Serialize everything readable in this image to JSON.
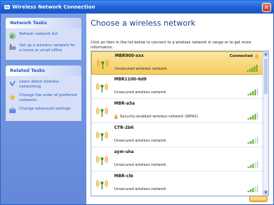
{
  "window": {
    "title": "Wireless Network Connection",
    "close_label": "✕"
  },
  "sidebar": {
    "network_tasks": {
      "title": "Network Tasks",
      "items": [
        {
          "label": "Refresh network list",
          "icon": "refresh-icon"
        },
        {
          "label": "Set up a wireless network for a home or small office",
          "icon": "setup-network-icon"
        }
      ]
    },
    "related_tasks": {
      "title": "Related Tasks",
      "items": [
        {
          "label": "Learn about wireless networking",
          "icon": "info-icon"
        },
        {
          "label": "Change the order of preferred networks",
          "icon": "star-icon"
        },
        {
          "label": "Change advanced settings",
          "icon": "settings-icon"
        }
      ]
    }
  },
  "main": {
    "heading": "Choose a wireless network",
    "instructions": "Click an item in the list below to connect to a wireless network in range or to get more information.",
    "networks": [
      {
        "name": "MBR900-xxx",
        "security": "Unsecured wireless network",
        "status": "Connected",
        "signal": 5,
        "selected": true,
        "secured": false
      },
      {
        "name": "MBR1100-6d9",
        "security": "Unsecured wireless network",
        "status": "",
        "signal": 4,
        "selected": false,
        "secured": false
      },
      {
        "name": "MBR-a5a",
        "security": "Security-enabled wireless network (WPA2)",
        "status": "",
        "signal": 4,
        "selected": false,
        "secured": true
      },
      {
        "name": "CTR-2b6",
        "security": "Unsecured wireless network",
        "status": "",
        "signal": 3,
        "selected": false,
        "secured": false
      },
      {
        "name": "aym-sha",
        "security": "Unsecured wireless network",
        "status": "",
        "signal": 3,
        "selected": false,
        "secured": false
      },
      {
        "name": "MBR-clb",
        "security": "Unsecured wireless network",
        "status": "",
        "signal": 3,
        "selected": false,
        "secured": false
      }
    ],
    "connect_label": "Connect"
  },
  "colors": {
    "title_bar": "#1e5fd3",
    "selected_row": "#f4cc5e",
    "link": "#215dc6",
    "signal": "#6fb13a"
  }
}
